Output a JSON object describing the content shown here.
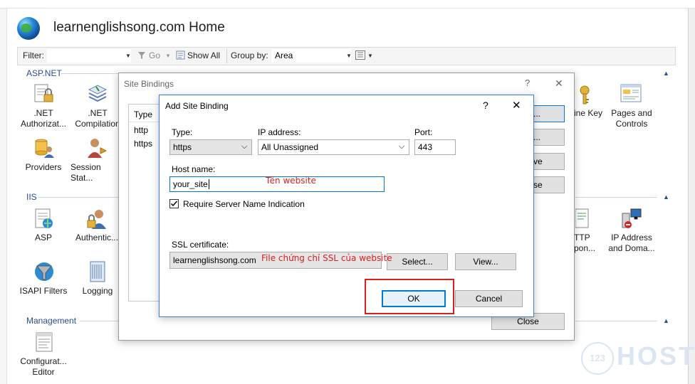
{
  "window": {
    "title": "learnenglishsong.com Home"
  },
  "filterbar": {
    "filter_label": "Filter:",
    "go_label": "Go",
    "show_all_label": "Show All",
    "group_by_label": "Group by:",
    "group_by_value": "Area"
  },
  "sections": {
    "aspnet": "ASP.NET",
    "iis": "IIS",
    "management": "Management"
  },
  "features": {
    "net_authorization": ".NET\nAuthorizat...",
    "net_compilation": ".NET\nCompilation",
    "providers": "Providers",
    "session_state": "Session Stat...",
    "asp": "ASP",
    "authentication": "Authentic...",
    "isapi_filters": "ISAPI Filters",
    "logging": "Logging",
    "machine_key": "ine Key",
    "pages_controls": "Pages and\nControls",
    "http": "TTP\npon...",
    "ip_address": "IP Address\nand Doma...",
    "configuration_editor": "Configurat...\nEditor"
  },
  "site_bindings": {
    "title": "Site Bindings",
    "help": "?",
    "column_type": "Type",
    "rows": [
      "http",
      "https"
    ],
    "btn_add_partial": "...",
    "btn_edit_partial": "...",
    "btn_remove_partial": "ve",
    "btn_browse_partial": "se",
    "close_label": "Close"
  },
  "add_binding": {
    "title": "Add Site Binding",
    "help": "?",
    "type_label": "Type:",
    "type_value": "https",
    "ip_label": "IP address:",
    "ip_value": "All Unassigned",
    "port_label": "Port:",
    "port_value": "443",
    "host_label": "Host name:",
    "host_value": "your_site",
    "host_annotation": "Tên website",
    "sni_label": "Require Server Name Indication",
    "sni_checked": true,
    "ssl_label": "SSL certificate:",
    "ssl_value": "learnenglishsong.com",
    "ssl_annotation": "File chứng chỉ SSL của website",
    "select_label": "Select...",
    "view_label": "View...",
    "ok_label": "OK",
    "cancel_label": "Cancel"
  },
  "watermark": {
    "brand": "HOST",
    "badge": "123"
  },
  "colors": {
    "accent_blue": "#2a4d8f",
    "highlight_red": "#d92020",
    "focus_blue": "#0078d7"
  }
}
